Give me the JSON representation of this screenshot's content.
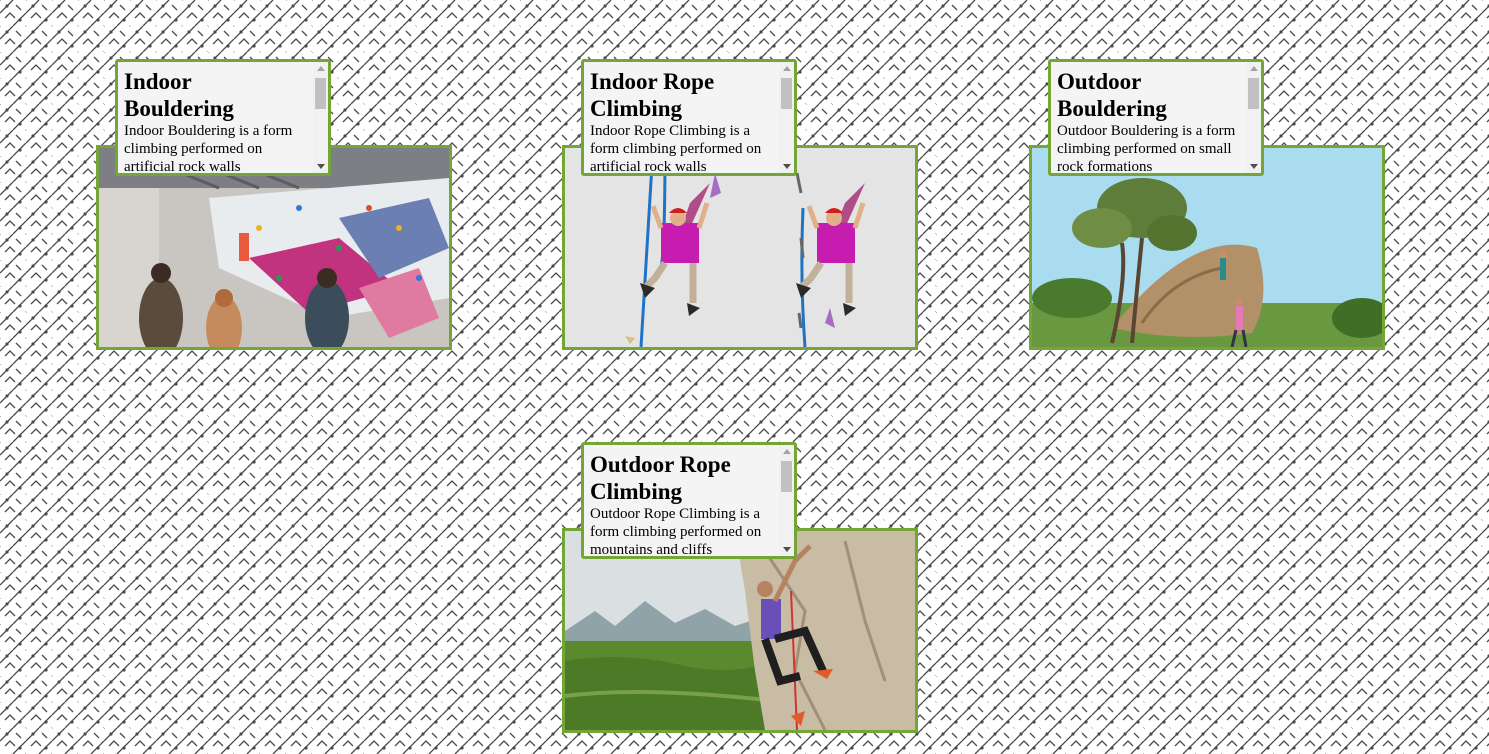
{
  "page": {
    "border_color": "#73a636",
    "caption_background": "#f4f4f4",
    "background_pattern": "diagonal-maze-with-dots"
  },
  "cards": [
    {
      "title": "Indoor Bouldering",
      "description": "Indoor Bouldering is a form climbing performed on artificial rock walls",
      "image": "indoor-bouldering-gym-photo"
    },
    {
      "title": "Indoor Rope Climbing",
      "description": "Indoor Rope Climbing is a form climbing performed on artificial rock walls",
      "image": "rope-climber-illustration"
    },
    {
      "title": "Outdoor Bouldering",
      "description": "Outdoor Bouldering is a form climbing performed on small rock formations",
      "image": "boulder-under-tree-photo"
    },
    {
      "title": "Outdoor Rope Climbing",
      "description": "Outdoor Rope Climbing is a form climbing performed on mountains and cliffs",
      "image": "cliff-climber-photo"
    }
  ]
}
